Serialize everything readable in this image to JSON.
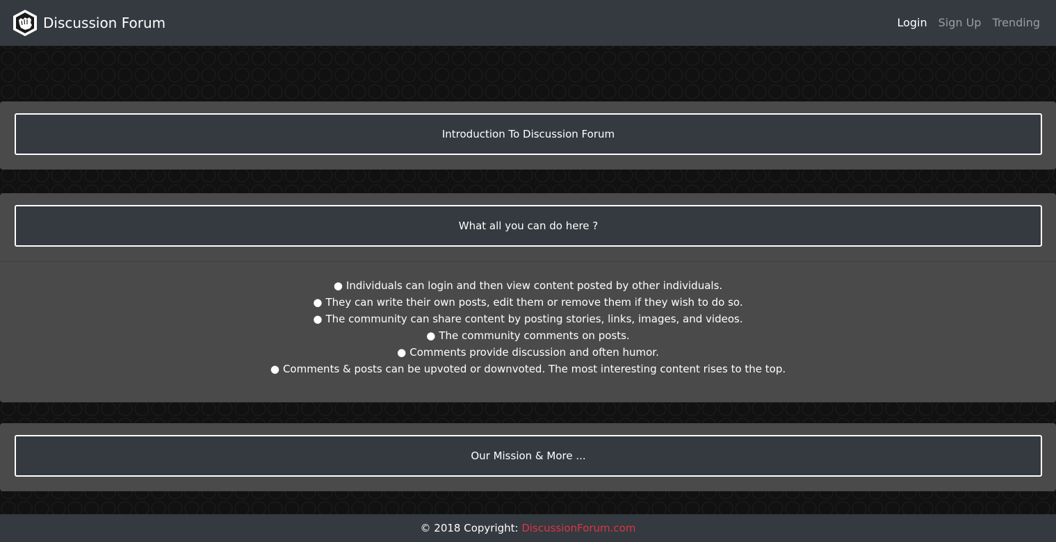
{
  "navbar": {
    "brand": "Discussion Forum",
    "logo_icon": "fist-logo-icon",
    "links": [
      {
        "label": "Login",
        "active": true
      },
      {
        "label": "Sign Up",
        "active": false
      },
      {
        "label": "Trending",
        "active": false
      }
    ]
  },
  "sections": [
    {
      "title": "Introduction To Discussion Forum"
    },
    {
      "title": "What all you can do here ?",
      "items": [
        "Individuals can login and then view content posted by other individuals.",
        "They can write their own posts, edit them or remove them if they wish to do so.",
        "The community can share content by posting stories, links, images, and videos.",
        "The community comments on posts.",
        "Comments provide discussion and often humor.",
        "Comments & posts can be upvoted or downvoted. The most interesting content rises to the top."
      ]
    },
    {
      "title": "Our Mission & More ..."
    }
  ],
  "bullet": "●",
  "footer": {
    "copyright": "© 2018 Copyright: ",
    "link": "DiscussionForum.com",
    "link_color": "#dc3545"
  },
  "colors": {
    "navbar_bg": "#343a40",
    "card_bg": "#4a4a4a",
    "page_bg": "#111111"
  }
}
